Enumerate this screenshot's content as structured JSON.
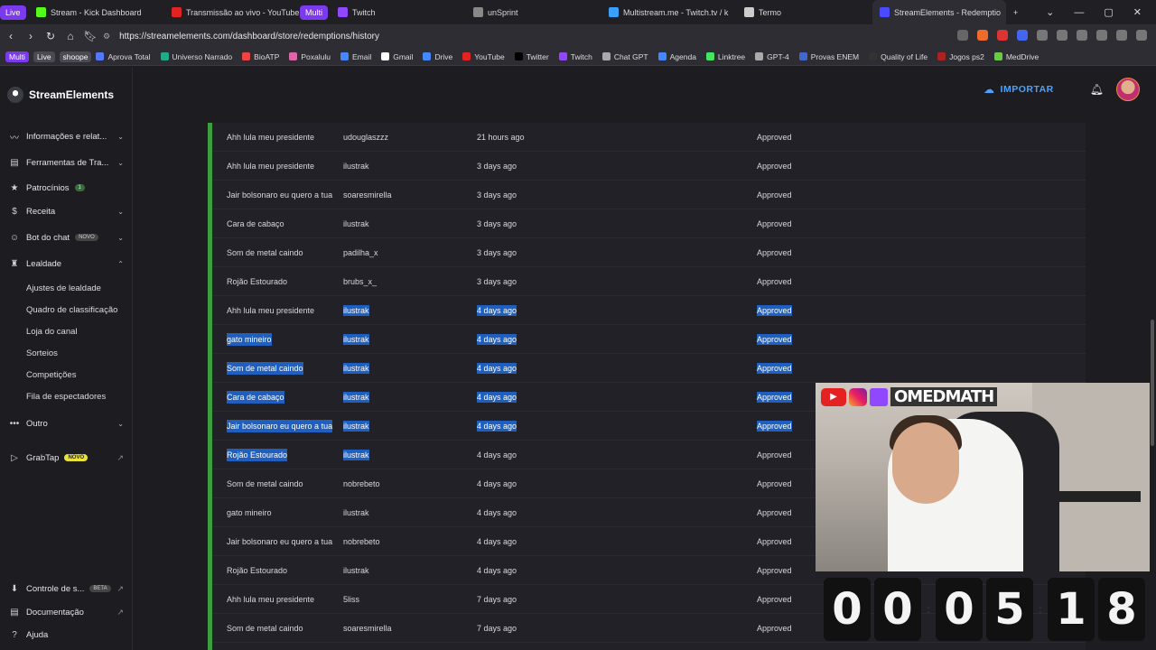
{
  "browser": {
    "tabs": [
      {
        "label": "Live",
        "pill": true,
        "color": "#7b3aed"
      },
      {
        "label": "Stream - Kick Dashboard",
        "fav": "#53fc18"
      },
      {
        "label": "Transmissão ao vivo - YouTube St",
        "fav": "#e52222"
      },
      {
        "label": "Multi",
        "pill": true,
        "color": "#7b3aed"
      },
      {
        "label": "Twitch",
        "fav": "#9146ff"
      },
      {
        "label": "unSprint",
        "fav": "#888888"
      },
      {
        "label": "Multistream.me - Twitch.tv / k",
        "fav": "#3aa0ff"
      },
      {
        "label": "Termo",
        "fav": "#cccccc"
      },
      {
        "label": "StreamElements - Redemptio",
        "fav": "#4a4aff",
        "active": true
      }
    ],
    "new_tab": "+",
    "window_controls": [
      "⌄",
      "—",
      "▢",
      "✕"
    ],
    "url": "https://streamelements.com/dashboard/store/redemptions/history",
    "bookmarks": [
      {
        "label": "Multi",
        "style": "pillp"
      },
      {
        "label": "Live",
        "style": "pillg"
      },
      {
        "label": "shoope",
        "style": "pillg"
      },
      {
        "label": "Aprova Total",
        "fav": "#5577ff"
      },
      {
        "label": "Universo Narrado",
        "fav": "#22aa88"
      },
      {
        "label": "BioATP",
        "fav": "#ee4444"
      },
      {
        "label": "Poxalulu",
        "fav": "#dd66aa"
      },
      {
        "label": "Email",
        "fav": "#4488ff"
      },
      {
        "label": "Gmail",
        "fav": "#ffffff"
      },
      {
        "label": "Drive",
        "fav": "#4488ff"
      },
      {
        "label": "YouTube",
        "fav": "#e52222"
      },
      {
        "label": "Twitter",
        "fav": "#000000"
      },
      {
        "label": "Twitch",
        "fav": "#9146ff"
      },
      {
        "label": "Chat GPT",
        "fav": "#aaaaaa"
      },
      {
        "label": "Agenda",
        "fav": "#4488ff"
      },
      {
        "label": "Linktree",
        "fav": "#43e660"
      },
      {
        "label": "GPT-4",
        "fav": "#aaaaaa"
      },
      {
        "label": "Provas ENEM",
        "fav": "#4466cc"
      },
      {
        "label": "Quality of Life",
        "fav": "#333333"
      },
      {
        "label": "Jogos ps2",
        "fav": "#aa2222"
      },
      {
        "label": "MedDrive",
        "fav": "#66cc44"
      }
    ]
  },
  "sidebar": {
    "brand": "StreamElements",
    "items": [
      {
        "label": "Informações e relat...",
        "icon": "chart-icon",
        "glyph": "〰",
        "chevron": "⌄"
      },
      {
        "label": "Ferramentas de Tra...",
        "icon": "tools-icon",
        "glyph": "▤",
        "chevron": "⌄"
      },
      {
        "label": "Patrocínios",
        "icon": "star-icon",
        "glyph": "★",
        "badge": "1"
      },
      {
        "label": "Receita",
        "icon": "dollar-icon",
        "glyph": "$",
        "chevron": "⌄"
      },
      {
        "label": "Bot do chat",
        "icon": "bot-icon",
        "glyph": "☺",
        "badge": "NOVO",
        "chevron": "⌄"
      },
      {
        "label": "Lealdade",
        "icon": "trophy-icon",
        "glyph": "♜",
        "chevron": "⌃"
      }
    ],
    "subitems": [
      "Ajustes de lealdade",
      "Quadro de classificação",
      "Loja do canal",
      "Sorteios",
      "Competições",
      "Fila de espectadores"
    ],
    "outro": {
      "label": "Outro",
      "glyph": "•••",
      "chevron": "⌄"
    },
    "grabtap": {
      "label": "GrabTap",
      "badge": "NOVO"
    },
    "footer": [
      {
        "label": "Controle de s...",
        "badge": "BETA",
        "glyph": "⬇"
      },
      {
        "label": "Documentação",
        "glyph": "▤"
      },
      {
        "label": "Ajuda",
        "glyph": "?"
      }
    ]
  },
  "header": {
    "import_label": "IMPORTAR"
  },
  "redemptions": [
    {
      "item": "Ahh lula meu presidente",
      "user": "udouglaszzz",
      "time": "21 hours ago",
      "status": "Approved",
      "hl": [
        false,
        false,
        false,
        false
      ]
    },
    {
      "item": "Ahh lula meu presidente",
      "user": "ilustrak",
      "time": "3 days ago",
      "status": "Approved",
      "hl": [
        false,
        false,
        false,
        false
      ]
    },
    {
      "item": "Jair bolsonaro eu quero a tua",
      "user": "soaresmirella",
      "time": "3 days ago",
      "status": "Approved",
      "hl": [
        false,
        false,
        false,
        false
      ]
    },
    {
      "item": "Cara de cabaço",
      "user": "ilustrak",
      "time": "3 days ago",
      "status": "Approved",
      "hl": [
        false,
        false,
        false,
        false
      ]
    },
    {
      "item": "Som de metal caindo",
      "user": "padilha_x",
      "time": "3 days ago",
      "status": "Approved",
      "hl": [
        false,
        false,
        false,
        false
      ]
    },
    {
      "item": "Rojão Estourado",
      "user": "brubs_x_",
      "time": "3 days ago",
      "status": "Approved",
      "hl": [
        false,
        false,
        false,
        false
      ]
    },
    {
      "item": "Ahh lula meu presidente",
      "user": "ilustrak",
      "time": "4 days ago",
      "status": "Approved",
      "hl": [
        false,
        true,
        true,
        true
      ]
    },
    {
      "item": "gato mineiro",
      "user": "ilustrak",
      "time": "4 days ago",
      "status": "Approved",
      "hl": [
        true,
        true,
        true,
        true
      ]
    },
    {
      "item": "Som de metal caindo",
      "user": "ilustrak",
      "time": "4 days ago",
      "status": "Approved",
      "hl": [
        true,
        true,
        true,
        true
      ]
    },
    {
      "item": "Cara de cabaço",
      "user": "ilustrak",
      "time": "4 days ago",
      "status": "Approved",
      "hl": [
        true,
        true,
        true,
        true
      ]
    },
    {
      "item": "Jair bolsonaro eu quero a tua",
      "user": "ilustrak",
      "time": "4 days ago",
      "status": "Approved",
      "hl": [
        true,
        true,
        true,
        true
      ]
    },
    {
      "item": "Rojão Estourado",
      "user": "ilustrak",
      "time": "4 days ago",
      "status": "Approved",
      "hl": [
        true,
        true,
        false,
        false
      ]
    },
    {
      "item": "Som de metal caindo",
      "user": "nobrebeto",
      "time": "4 days ago",
      "status": "Approved",
      "hl": [
        false,
        false,
        false,
        false
      ]
    },
    {
      "item": "gato mineiro",
      "user": "ilustrak",
      "time": "4 days ago",
      "status": "Approved",
      "hl": [
        false,
        false,
        false,
        false
      ]
    },
    {
      "item": "Jair bolsonaro eu quero a tua",
      "user": "nobrebeto",
      "time": "4 days ago",
      "status": "Approved",
      "hl": [
        false,
        false,
        false,
        false
      ]
    },
    {
      "item": "Rojão Estourado",
      "user": "ilustrak",
      "time": "4 days ago",
      "status": "Approved",
      "hl": [
        false,
        false,
        false,
        false
      ]
    },
    {
      "item": "Ahh lula meu presidente",
      "user": "5liss",
      "time": "7 days ago",
      "status": "Approved",
      "hl": [
        false,
        false,
        false,
        false
      ]
    },
    {
      "item": "Som de metal caindo",
      "user": "soaresmirella",
      "time": "7 days ago",
      "status": "Approved",
      "hl": [
        false,
        false,
        false,
        false
      ]
    }
  ],
  "overlay": {
    "channel_name": "OMEDMATH",
    "timer_digits": [
      "0",
      "0",
      "0",
      "5",
      "1",
      "8"
    ]
  }
}
